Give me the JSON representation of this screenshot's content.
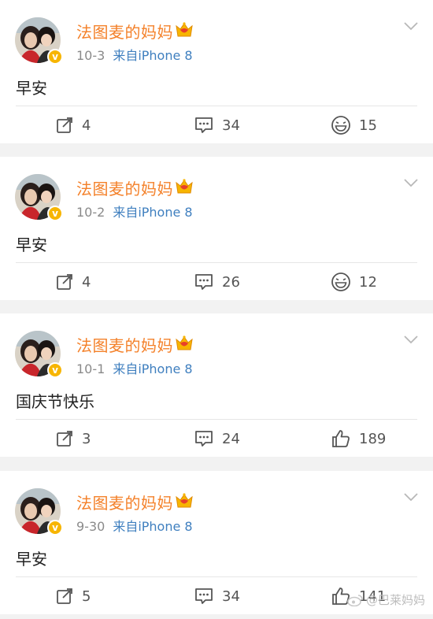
{
  "colors": {
    "username": "#f4812a",
    "source_link": "#3f7fbf",
    "badge": "#f7b500",
    "meta_gray": "#8a8a8a"
  },
  "posts": [
    {
      "author": "法图麦的妈妈",
      "date": "10-3",
      "source": "来自iPhone 8",
      "text": "早安",
      "reposts": "4",
      "comments": "34",
      "likes": "15",
      "like_icon": "laugh-emoji-icon"
    },
    {
      "author": "法图麦的妈妈",
      "date": "10-2",
      "source": "来自iPhone 8",
      "text": "早安",
      "reposts": "4",
      "comments": "26",
      "likes": "12",
      "like_icon": "laugh-emoji-icon"
    },
    {
      "author": "法图麦的妈妈",
      "date": "10-1",
      "source": "来自iPhone 8",
      "text": "国庆节快乐",
      "reposts": "3",
      "comments": "24",
      "likes": "189",
      "like_icon": "thumbs-up-icon"
    },
    {
      "author": "法图麦的妈妈",
      "date": "9-30",
      "source": "来自iPhone 8",
      "text": "早安",
      "reposts": "5",
      "comments": "34",
      "likes": "141",
      "like_icon": "thumbs-up-icon"
    }
  ],
  "watermark": "@巴莱妈妈",
  "badge_letter": "v"
}
